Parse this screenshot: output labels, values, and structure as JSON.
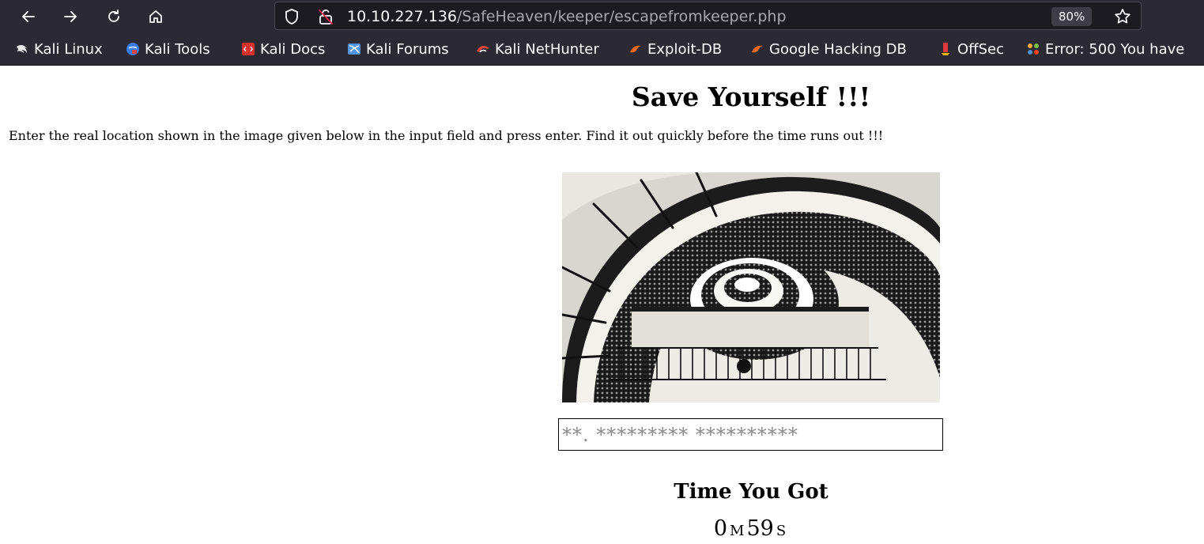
{
  "browser": {
    "url_host": "10.10.227.136",
    "url_path": "/SafeHeaven/keeper/escapefromkeeper.php",
    "zoom": "80%",
    "bookmarks": [
      {
        "label": "Kali Linux",
        "icon": "kali-dragon-icon",
        "color": "#e8e8e8"
      },
      {
        "label": "Kali Tools",
        "icon": "kali-tools-icon",
        "color": "#367bf0"
      },
      {
        "label": "Kali Docs",
        "icon": "kali-docs-icon",
        "color": "#d9302c"
      },
      {
        "label": "Kali Forums",
        "icon": "kali-forums-icon",
        "color": "#5294e2"
      },
      {
        "label": "Kali NetHunter",
        "icon": "nethunter-icon",
        "color": "#e0433a"
      },
      {
        "label": "Exploit-DB",
        "icon": "exploit-db-icon",
        "color": "#f06a1d"
      },
      {
        "label": "Google Hacking DB",
        "icon": "ghdb-icon",
        "color": "#f06a1d"
      },
      {
        "label": "OffSec",
        "icon": "offsec-icon",
        "color": "#e03a3e"
      },
      {
        "label": "Error: 500 You have",
        "icon": "joomla-icon",
        "color": "#f9a541"
      }
    ]
  },
  "page": {
    "title": "Save Yourself !!!",
    "instructions": "Enter the real location shown in the image given below in the input field and press enter. Find it out quickly before the time runs out !!!",
    "answer_placeholder": "**. ********* **********",
    "time_heading": "Time You Got",
    "timer": {
      "minutes": "0",
      "minutes_unit": "M",
      "seconds": "59",
      "seconds_unit": "S"
    }
  }
}
